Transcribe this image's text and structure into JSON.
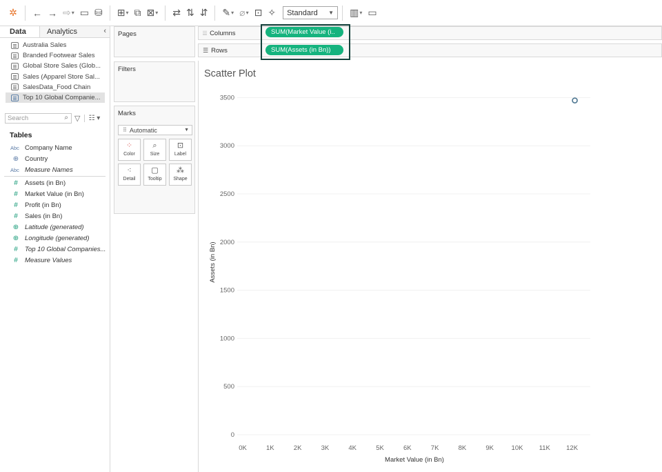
{
  "toolbar": {
    "icons": [
      "tableau-logo-icon",
      "undo-icon",
      "redo-icon",
      "replay-icon",
      "save-icon",
      "new-data-source-icon",
      "new-worksheet-icon",
      "duplicate-icon",
      "clear-sheet-icon",
      "swap-icon",
      "sort-ascending-icon",
      "sort-descending-icon",
      "highlight-icon",
      "group-icon",
      "label-icon",
      "pin-icon",
      "show-me-icon",
      "presentation-icon"
    ],
    "fit_select": "Standard"
  },
  "data_pane": {
    "tabs": [
      "Data",
      "Analytics"
    ],
    "sources": [
      "Australia Sales",
      "Branded Footwear Sales",
      "Global Store Sales (Glob...",
      "Sales (Apparel Store Sal...",
      "SalesData_Food Chain",
      "Top 10 Global Companie..."
    ],
    "search_placeholder": "Search",
    "tables_heading": "Tables",
    "dimensions": [
      {
        "type": "Abc",
        "label": "Company Name",
        "italic": false
      },
      {
        "type": "geo",
        "label": "Country",
        "italic": false
      },
      {
        "type": "Abc",
        "label": "Measure Names",
        "italic": true
      }
    ],
    "measures": [
      {
        "type": "#",
        "label": "Assets (in Bn)",
        "italic": false
      },
      {
        "type": "#",
        "label": "Market Value (in Bn)",
        "italic": false
      },
      {
        "type": "#",
        "label": "Profit (in Bn)",
        "italic": false
      },
      {
        "type": "#",
        "label": "Sales (in Bn)",
        "italic": false
      },
      {
        "type": "geo",
        "label": "Latitude (generated)",
        "italic": true
      },
      {
        "type": "geo",
        "label": "Longitude (generated)",
        "italic": true
      },
      {
        "type": "#",
        "label": "Top 10 Global Companies...",
        "italic": true
      },
      {
        "type": "#",
        "label": "Measure Values",
        "italic": true
      }
    ]
  },
  "cards": {
    "pages": "Pages",
    "filters": "Filters",
    "marks": "Marks",
    "mark_type": "Automatic",
    "mark_buttons": [
      "Color",
      "Size",
      "Label",
      "Detail",
      "Tooltip",
      "Shape"
    ]
  },
  "shelves": {
    "columns_label": "Columns",
    "rows_label": "Rows",
    "columns_pill": "SUM(Market Value (i..",
    "rows_pill": "SUM(Assets (in Bn))"
  },
  "viz": {
    "title": "Scatter Plot"
  },
  "chart_data": {
    "type": "scatter",
    "title": "Scatter Plot",
    "xlabel": "Market Value (in Bn)",
    "ylabel": "Assets (in Bn)",
    "x_ticks": [
      "0K",
      "1K",
      "2K",
      "3K",
      "4K",
      "5K",
      "6K",
      "7K",
      "8K",
      "9K",
      "10K",
      "11K",
      "12K"
    ],
    "y_ticks": [
      "0",
      "500",
      "1000",
      "1500",
      "2000",
      "2500",
      "3000",
      "3500"
    ],
    "xlim": [
      0,
      12500
    ],
    "ylim": [
      0,
      3600
    ],
    "points": [
      {
        "x": 12100,
        "y": 3470
      }
    ],
    "marker_color": "#4e7791"
  }
}
